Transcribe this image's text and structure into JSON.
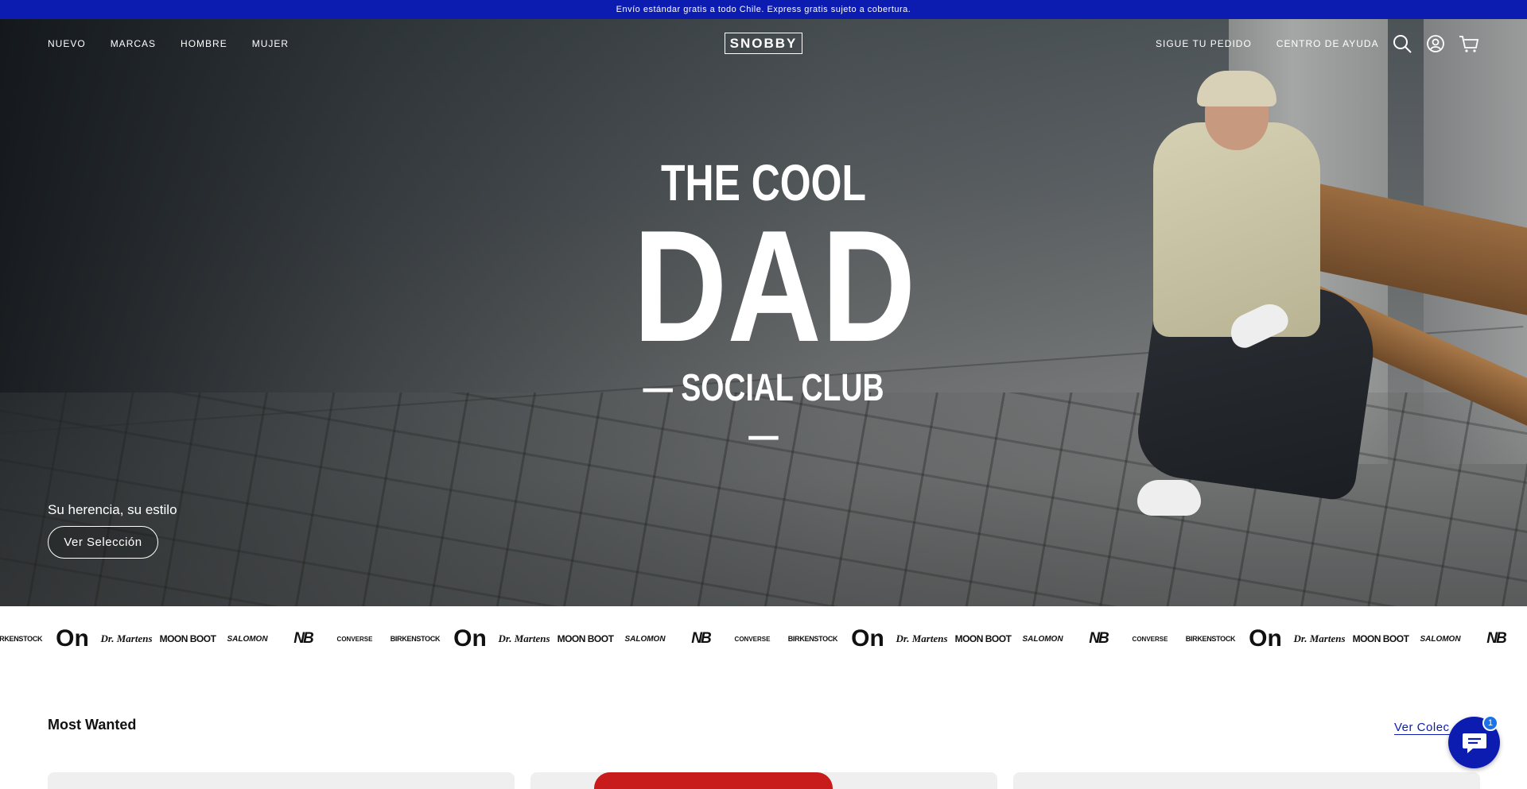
{
  "announcement": "Envío estándar gratis a todo Chile. Express gratis sujeto a cobertura.",
  "nav": {
    "left_links": [
      "NUEVO",
      "MARCAS",
      "HOMBRE",
      "MUJER"
    ],
    "logo": "SNOBBY",
    "right_links": [
      "SIGUE TU PEDIDO",
      "CENTRO DE AYUDA"
    ],
    "icons": [
      "search-icon",
      "account-icon",
      "cart-icon"
    ]
  },
  "hero": {
    "line1": "THE COOL",
    "line2": "DAD",
    "line3": "— SOCIAL CLUB —",
    "tagline": "Su herencia, su estilo",
    "cta_label": "Ver Selección"
  },
  "brands": [
    "BIRKENSTOCK",
    "On",
    "Dr. Martens",
    "MOON BOOT",
    "SALOMON",
    "NB",
    "CONVERSE"
  ],
  "most_wanted": {
    "title": "Most Wanted",
    "link_label": "Ver Colec"
  },
  "chat": {
    "badge_count": "1"
  },
  "colors": {
    "brand_blue": "#0c1bb0",
    "text_dark": "#111111",
    "card_bg": "#efefef"
  }
}
